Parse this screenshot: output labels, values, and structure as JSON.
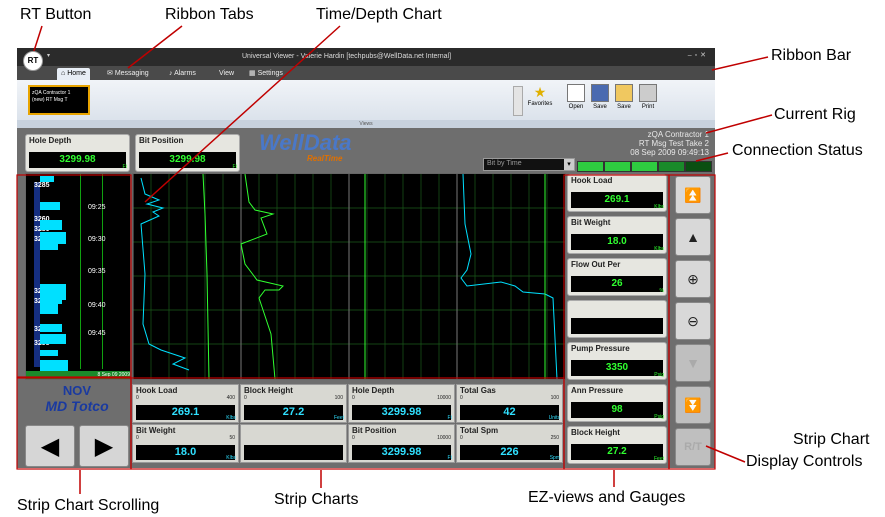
{
  "callouts": {
    "rt_button": "RT Button",
    "ribbon_tabs": "Ribbon Tabs",
    "time_depth_chart": "Time/Depth Chart",
    "ribbon_bar": "Ribbon Bar",
    "current_rig": "Current Rig",
    "connection_status": "Connection Status",
    "strip_chart_display_controls_1": "Strip Chart",
    "strip_chart_display_controls_2": "Display Controls",
    "strip_chart_scrolling": "Strip Chart Scrolling",
    "strip_charts": "Strip Charts",
    "ez_views_and_gauges": "EZ-views and Gauges"
  },
  "window": {
    "title": "Universal Viewer - Valerie Hardin [techpubs@WellData.net Internal]",
    "rt_label": "RT"
  },
  "tabs": [
    "Home",
    "Messaging",
    "Alarms",
    "View",
    "Settings"
  ],
  "ribbon": {
    "thumb_line1": "zQA Contractor 1",
    "thumb_line2": "(new) RT Msg T",
    "group_label": "Views",
    "buttons": [
      "Favorites",
      "Open",
      "Save",
      "Save",
      "Print"
    ]
  },
  "top_gauges": {
    "hole_depth": {
      "label": "Hole Depth",
      "value": "3299.98",
      "unit": "Ft"
    },
    "bit_position": {
      "label": "Bit Position",
      "value": "3299.98",
      "unit": "Ft"
    }
  },
  "logo": {
    "line1": "WellData",
    "line2": "RealTime"
  },
  "rig": {
    "name": "zQA Contractor 1",
    "job": "RT Msg Test Take 2",
    "datetime": "08 Sep 2009 09:49:13"
  },
  "time_select": {
    "value": "Bit by Time"
  },
  "connection_colors": [
    "#2ecc40",
    "#2ecc40",
    "#2ecc40",
    "#1a8a2a",
    "#0a4f12"
  ],
  "time_depth": {
    "depth_labels": [
      "3285",
      "3260",
      "3280",
      "3240",
      "3265",
      "3280",
      "3290",
      "3295"
    ],
    "time_labels": [
      "09:25",
      "09:30",
      "09:35",
      "09:40",
      "09:45"
    ],
    "bottom_date": "8 Sep 09 2009"
  },
  "strip_boxes": [
    {
      "label": "Hook Load",
      "min": "0",
      "max": "400",
      "value": "269.1",
      "unit": "Klbs"
    },
    {
      "label": "Block Height",
      "min": "0",
      "max": "100",
      "value": "27.2",
      "unit": "Feet"
    },
    {
      "label": "Hole Depth",
      "min": "0",
      "max": "10000",
      "value": "3299.98",
      "unit": "Ft"
    },
    {
      "label": "Total Gas",
      "min": "0",
      "max": "100",
      "value": "42",
      "unit": "Units"
    },
    {
      "label": "Bit Weight",
      "min": "0",
      "max": "50",
      "value": "18.0",
      "unit": "Klbs"
    },
    {
      "label": "",
      "min": "",
      "max": "",
      "value": "",
      "unit": ""
    },
    {
      "label": "Bit Position",
      "min": "0",
      "max": "10000",
      "value": "3299.98",
      "unit": "Ft"
    },
    {
      "label": "Total Spm",
      "min": "0",
      "max": "250",
      "value": "226",
      "unit": "Spm"
    }
  ],
  "ez_gauges": [
    {
      "label": "Hook Load",
      "value": "269.1",
      "unit": "Klbs"
    },
    {
      "label": "Bit Weight",
      "value": "18.0",
      "unit": "Klbs"
    },
    {
      "label": "Flow Out Per",
      "value": "26",
      "unit": "%"
    },
    {
      "label": "",
      "value": "",
      "unit": ""
    },
    {
      "label": "Pump Pressure",
      "value": "3350",
      "unit": "Psig"
    },
    {
      "label": "Ann Pressure",
      "value": "98",
      "unit": "Psig"
    },
    {
      "label": "Block Height",
      "value": "27.2",
      "unit": "Feet"
    }
  ],
  "display_controls": {
    "rt_label": "R/T"
  },
  "brand": {
    "logo_top": "NOV",
    "logo_bottom": "MD Totco"
  }
}
